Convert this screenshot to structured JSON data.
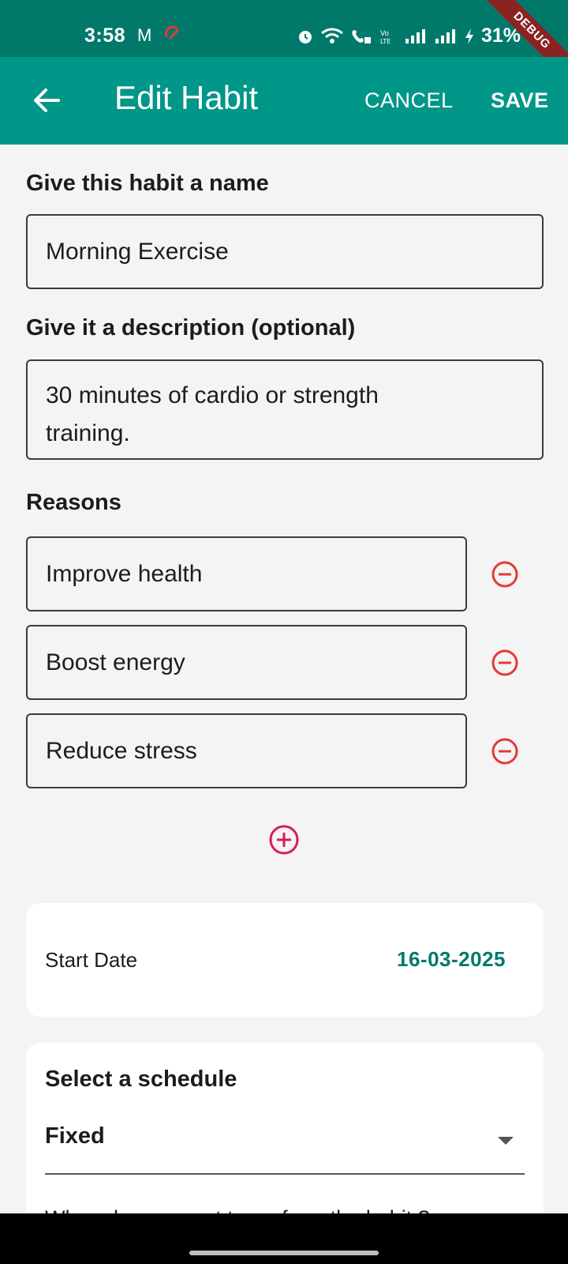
{
  "status_bar": {
    "time": "3:58",
    "gmail_icon": "M",
    "battery": "31%",
    "debug_label": "DEBUG"
  },
  "app_bar": {
    "title": "Edit Habit",
    "cancel_label": "CANCEL",
    "save_label": "SAVE"
  },
  "form": {
    "name_label": "Give this habit a name",
    "name_value": "Morning Exercise",
    "description_label": "Give it a description (optional)",
    "description_value": "30 minutes of cardio or strength training.",
    "reasons_label": "Reasons",
    "reasons": [
      {
        "value": "Improve health"
      },
      {
        "value": "Boost energy"
      },
      {
        "value": "Reduce stress"
      }
    ]
  },
  "start_date": {
    "label": "Start Date",
    "value": "16-03-2025"
  },
  "schedule": {
    "title": "Select a schedule",
    "selected": "Fixed",
    "question": "When do you want to perform the habit ?"
  },
  "colors": {
    "status_bar": "#00796b",
    "app_bar": "#009688",
    "accent": "#00796b",
    "remove_icon": "#e53935",
    "add_icon": "#d81b60"
  },
  "icons": {
    "back": "arrow-left-icon",
    "remove": "minus-circle-icon",
    "add": "plus-circle-icon",
    "dropdown": "caret-down-icon"
  }
}
